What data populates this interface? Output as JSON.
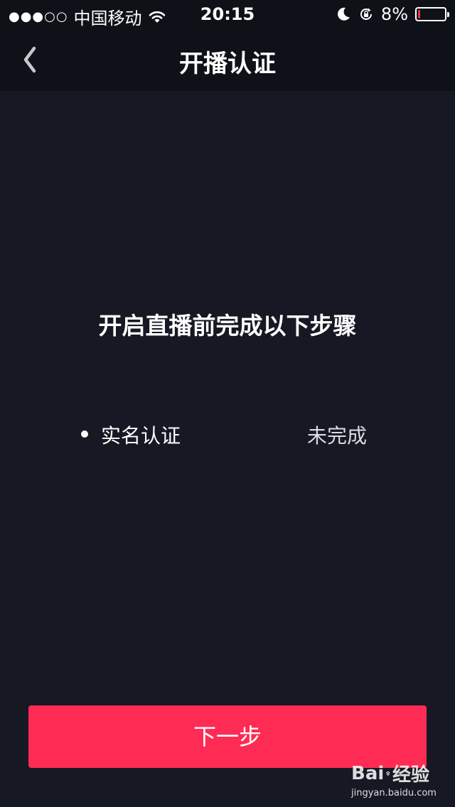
{
  "status_bar": {
    "signal": "●●●○○",
    "carrier": "中国移动",
    "time": "20:15",
    "battery_percent_label": "8%",
    "battery_level": 0.08,
    "battery_color": "#e8333f"
  },
  "nav": {
    "title": "开播认证",
    "back_icon": "chevron-left-icon"
  },
  "main": {
    "heading": "开启直播前完成以下步骤",
    "steps": [
      {
        "label": "实名认证",
        "status": "未完成"
      }
    ]
  },
  "footer": {
    "next_label": "下一步",
    "accent_color": "#fe2c55"
  },
  "watermark": {
    "logo_left": "Bai",
    "logo_right": "经验",
    "url": "jingyan.baidu.com"
  }
}
